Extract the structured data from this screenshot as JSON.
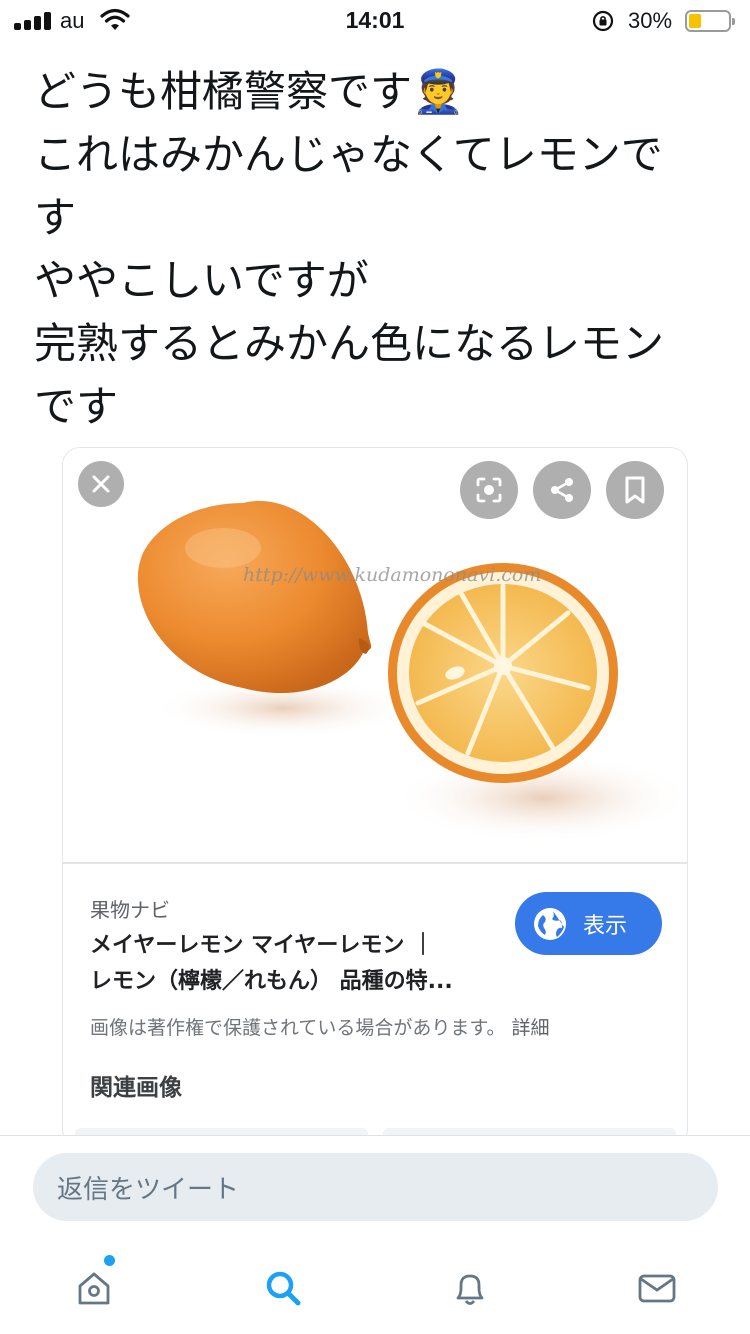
{
  "status_bar": {
    "carrier": "au",
    "time": "14:01",
    "battery_percent": "30%",
    "battery_level": 0.3,
    "battery_color": "#f7c300"
  },
  "tweet": {
    "lines": [
      "どうも柑橘警察です👮",
      "これはみかんじゃなくてレモンで",
      "す",
      "ややこしいですが",
      "完熟するとみかん色になるレモン",
      "です"
    ]
  },
  "card": {
    "image": {
      "watermark": "http://www.kudamononavi.com",
      "buttons": [
        "close-icon",
        "lens-icon",
        "share-icon",
        "bookmark-icon"
      ]
    },
    "source": "果物ナビ",
    "title_line1": "メイヤーレモン マイヤーレモン ｜",
    "title_line2": "レモン（檸檬／れもん） 品種の特...",
    "view_button": "表示",
    "copyright_notice": "画像は著作権で保護されている場合があります。",
    "detail_link": "詳細",
    "related_heading": "関連画像",
    "accent_color": "#3679e8"
  },
  "reply": {
    "placeholder": "返信をツイート"
  },
  "tab_bar": {
    "tabs": [
      "home-icon",
      "search-icon",
      "notifications-icon",
      "messages-icon"
    ],
    "active": "search",
    "active_color": "#1da1f2"
  }
}
